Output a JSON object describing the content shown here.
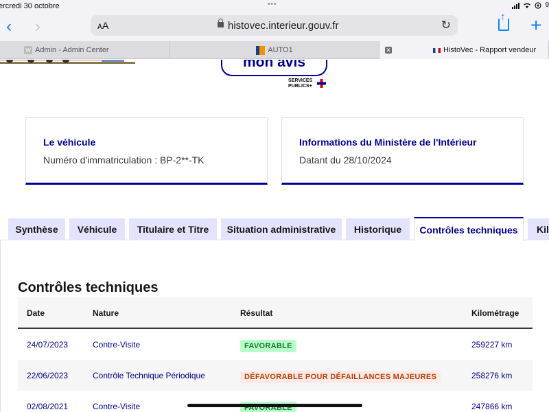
{
  "status": {
    "time": "ercredi 30 octobre",
    "dots": "•••",
    "battery_glyph": "9"
  },
  "browser": {
    "text_size_label": "ᴀA",
    "url": "histovec.interieur.gouv.fr",
    "reload_glyph": "↻",
    "back_glyph": "‹",
    "forward_glyph": "›",
    "new_tab_glyph": "+",
    "tabs": [
      {
        "favicon": "W",
        "label": "Admin - Admin Center"
      },
      {
        "label": "AUTO1"
      },
      {
        "close_glyph": "✕",
        "label": "HistoVec - Rapport vendeur"
      }
    ]
  },
  "header": {
    "avis_label": "mon avis",
    "services_publics_line1": "SERVICES",
    "services_publics_line2": "PUBLICS+"
  },
  "cards": {
    "vehicle": {
      "title": "Le véhicule",
      "text": "Numéro d'immatriculation : BP-2**-TK"
    },
    "ministry": {
      "title": "Informations du Ministère de l'Intérieur",
      "text": "Datant du 28/10/2024"
    }
  },
  "page_tabs": [
    {
      "label": "Synthèse"
    },
    {
      "label": "Véhicule"
    },
    {
      "label": "Titulaire et Titre"
    },
    {
      "label": "Situation administrative"
    },
    {
      "label": "Historique"
    },
    {
      "label": "Contrôles techniques"
    },
    {
      "label": "Kil"
    }
  ],
  "active_tab": "Contrôles techniques",
  "controls": {
    "title": "Contrôles techniques",
    "columns": {
      "date": "Date",
      "nature": "Nature",
      "result": "Résultat",
      "km": "Kilométrage"
    },
    "rows": [
      {
        "date": "24/07/2023",
        "nature": "Contre-Visite",
        "result": "FAVORABLE",
        "km": "259227 km"
      },
      {
        "date": "22/06/2023",
        "nature": "Contrôle Technique Périodique",
        "result": "DÉFAVORABLE POUR DÉFAILLANCES MAJEURES",
        "km": "258276 km"
      },
      {
        "date": "02/08/2021",
        "nature": "Contre-Visite",
        "result": "FAVORABLE",
        "km": "247866 km"
      }
    ]
  },
  "colors": {
    "brand_blue": "#000091",
    "ios_blue": "#0a84ff",
    "success_bg": "#b8fec9",
    "success_text": "#18753c",
    "error_bg": "#ffe9e6",
    "error_text": "#b34000"
  }
}
